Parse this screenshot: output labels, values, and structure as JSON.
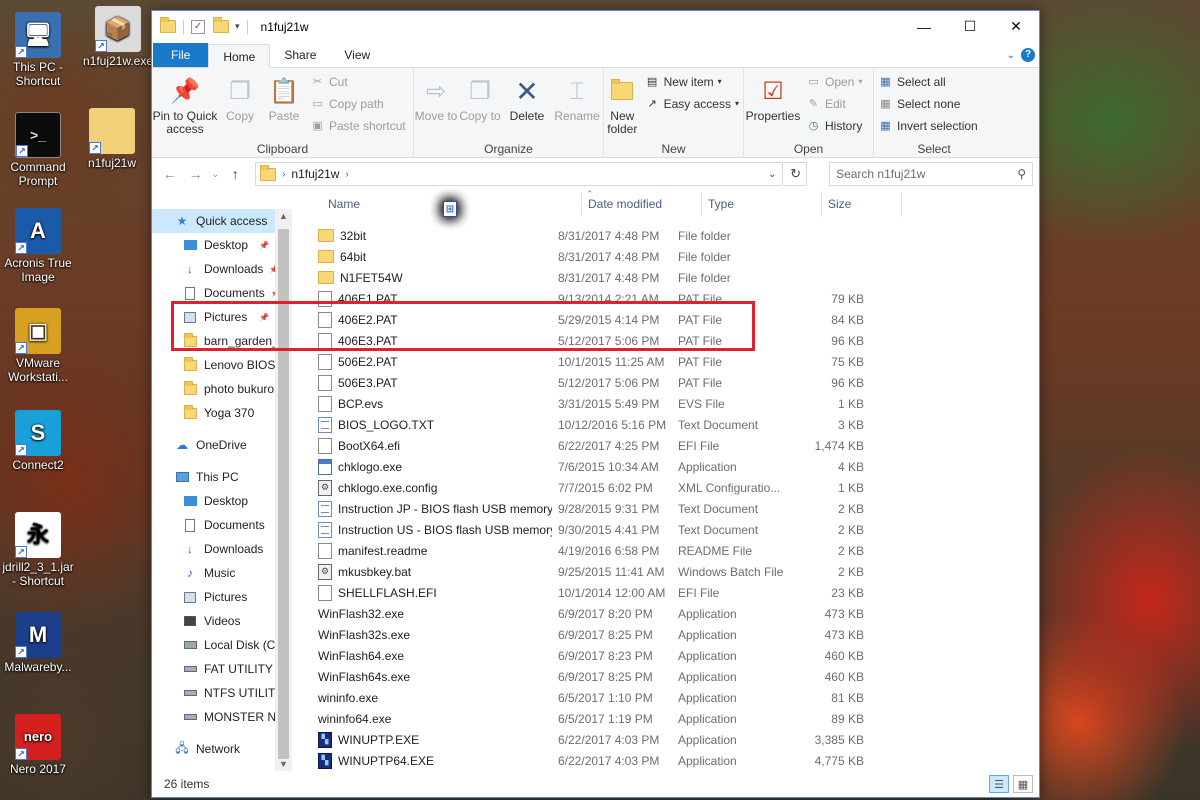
{
  "desktop": {
    "icons": [
      {
        "label": "This PC - Shortcut",
        "glyph": "🖥"
      },
      {
        "label": "n1fuj21w.exe",
        "glyph": "📦"
      },
      {
        "label": "Command Prompt",
        "glyph": ">_"
      },
      {
        "label": "n1fuj21w",
        "glyph": ""
      },
      {
        "label": "Acronis True Image",
        "glyph": "A"
      },
      {
        "label": "VMware Workstati...",
        "glyph": "▣"
      },
      {
        "label": "Connect2",
        "glyph": "S"
      },
      {
        "label": "jdrill2_3_1.jar - Shortcut",
        "glyph": "永"
      },
      {
        "label": "Malwareby...",
        "glyph": "M"
      },
      {
        "label": "Nero 2017",
        "glyph": "nero"
      }
    ]
  },
  "window": {
    "title": "n1fuj21w",
    "controls": {
      "minimize": "—",
      "maximize": "☐",
      "close": "✕"
    }
  },
  "tabs": {
    "file": "File",
    "home": "Home",
    "share": "Share",
    "view": "View"
  },
  "ribbon": {
    "clipboard": {
      "label": "Clipboard",
      "pin": "Pin to Quick access",
      "copy": "Copy",
      "paste": "Paste",
      "cut": "Cut",
      "copy_path": "Copy path",
      "paste_shortcut": "Paste shortcut"
    },
    "organize": {
      "label": "Organize",
      "move_to": "Move to",
      "copy_to": "Copy to",
      "delete": "Delete",
      "rename": "Rename"
    },
    "new": {
      "label": "New",
      "new_folder": "New folder",
      "new_item": "New item",
      "easy_access": "Easy access"
    },
    "open": {
      "label": "Open",
      "properties": "Properties",
      "open": "Open",
      "edit": "Edit",
      "history": "History"
    },
    "select": {
      "label": "Select",
      "select_all": "Select all",
      "select_none": "Select none",
      "invert": "Invert selection"
    }
  },
  "address": {
    "path": "n1fuj21w",
    "search_placeholder": "Search n1fuj21w"
  },
  "nav": {
    "quick_access": "Quick access",
    "quick_items": [
      {
        "label": "Desktop",
        "pinned": true
      },
      {
        "label": "Downloads",
        "pinned": true
      },
      {
        "label": "Documents",
        "pinned": true
      },
      {
        "label": "Pictures",
        "pinned": true
      },
      {
        "label": "barn_garden_wo",
        "pinned": false
      },
      {
        "label": "Lenovo BIOS Fla",
        "pinned": false
      },
      {
        "label": "photo bukuro",
        "pinned": false
      },
      {
        "label": "Yoga 370",
        "pinned": false
      }
    ],
    "onedrive": "OneDrive",
    "this_pc": "This PC",
    "pc_items": [
      {
        "label": "Desktop",
        "icon": "desktop-icon"
      },
      {
        "label": "Documents",
        "icon": "documents-icon"
      },
      {
        "label": "Downloads",
        "icon": "download-icon"
      },
      {
        "label": "Music",
        "icon": "music-icon"
      },
      {
        "label": "Pictures",
        "icon": "pictures-icon"
      },
      {
        "label": "Videos",
        "icon": "videos-icon"
      },
      {
        "label": "Local Disk (C:)",
        "icon": "local-disk-icon"
      },
      {
        "label": "FAT UTILITY (D:)",
        "icon": "drive-icon"
      },
      {
        "label": "NTFS UTILITY (E:",
        "icon": "drive-icon"
      },
      {
        "label": "MONSTER NTFS",
        "icon": "drive-icon"
      }
    ],
    "network": "Network"
  },
  "columns": {
    "name": "Name",
    "date": "Date modified",
    "type": "Type",
    "size": "Size"
  },
  "files": [
    {
      "name": "32bit",
      "date": "8/31/2017 4:48 PM",
      "type": "File folder",
      "size": "",
      "icon": "folder"
    },
    {
      "name": "64bit",
      "date": "8/31/2017 4:48 PM",
      "type": "File folder",
      "size": "",
      "icon": "folder"
    },
    {
      "name": "N1FET54W",
      "date": "8/31/2017 4:48 PM",
      "type": "File folder",
      "size": "",
      "icon": "folder"
    },
    {
      "name": "406E1.PAT",
      "date": "9/13/2014 2:21 AM",
      "type": "PAT File",
      "size": "79 KB",
      "icon": "doc"
    },
    {
      "name": "406E2.PAT",
      "date": "5/29/2015 4:14 PM",
      "type": "PAT File",
      "size": "84 KB",
      "icon": "doc"
    },
    {
      "name": "406E3.PAT",
      "date": "5/12/2017 5:06 PM",
      "type": "PAT File",
      "size": "96 KB",
      "icon": "doc"
    },
    {
      "name": "506E2.PAT",
      "date": "10/1/2015 11:25 AM",
      "type": "PAT File",
      "size": "75 KB",
      "icon": "doc"
    },
    {
      "name": "506E3.PAT",
      "date": "5/12/2017 5:06 PM",
      "type": "PAT File",
      "size": "96 KB",
      "icon": "doc"
    },
    {
      "name": "BCP.evs",
      "date": "3/31/2015 5:49 PM",
      "type": "EVS File",
      "size": "1 KB",
      "icon": "doc"
    },
    {
      "name": "BIOS_LOGO.TXT",
      "date": "10/12/2016 5:16 PM",
      "type": "Text Document",
      "size": "3 KB",
      "icon": "txt"
    },
    {
      "name": "BootX64.efi",
      "date": "6/22/2017 4:25 PM",
      "type": "EFI File",
      "size": "1,474 KB",
      "icon": "doc"
    },
    {
      "name": "chklogo.exe",
      "date": "7/6/2015 10:34 AM",
      "type": "Application",
      "size": "4 KB",
      "icon": "app"
    },
    {
      "name": "chklogo.exe.config",
      "date": "7/7/2015 6:02 PM",
      "type": "XML Configuratio...",
      "size": "1 KB",
      "icon": "gear"
    },
    {
      "name": "Instruction JP - BIOS flash USB memory k...",
      "date": "9/28/2015 9:31 PM",
      "type": "Text Document",
      "size": "2 KB",
      "icon": "txt"
    },
    {
      "name": "Instruction US - BIOS flash USB memory ...",
      "date": "9/30/2015 4:41 PM",
      "type": "Text Document",
      "size": "2 KB",
      "icon": "txt"
    },
    {
      "name": "manifest.readme",
      "date": "4/19/2016 6:58 PM",
      "type": "README File",
      "size": "2 KB",
      "icon": "doc"
    },
    {
      "name": "mkusbkey.bat",
      "date": "9/25/2015 11:41 AM",
      "type": "Windows Batch File",
      "size": "2 KB",
      "icon": "gear"
    },
    {
      "name": "SHELLFLASH.EFI",
      "date": "10/1/2014 12:00 AM",
      "type": "EFI File",
      "size": "23 KB",
      "icon": "doc"
    },
    {
      "name": "WinFlash32.exe",
      "date": "6/9/2017 8:20 PM",
      "type": "Application",
      "size": "473 KB",
      "icon": "win"
    },
    {
      "name": "WinFlash32s.exe",
      "date": "6/9/2017 8:25 PM",
      "type": "Application",
      "size": "473 KB",
      "icon": "win"
    },
    {
      "name": "WinFlash64.exe",
      "date": "6/9/2017 8:23 PM",
      "type": "Application",
      "size": "460 KB",
      "icon": "win"
    },
    {
      "name": "WinFlash64s.exe",
      "date": "6/9/2017 8:25 PM",
      "type": "Application",
      "size": "460 KB",
      "icon": "win"
    },
    {
      "name": "wininfo.exe",
      "date": "6/5/2017 1:10 PM",
      "type": "Application",
      "size": "81 KB",
      "icon": "win"
    },
    {
      "name": "wininfo64.exe",
      "date": "6/5/2017 1:19 PM",
      "type": "Application",
      "size": "89 KB",
      "icon": "win"
    },
    {
      "name": "WINUPTP.EXE",
      "date": "6/22/2017 4:03 PM",
      "type": "Application",
      "size": "3,385 KB",
      "icon": "blk"
    },
    {
      "name": "WINUPTP64.EXE",
      "date": "6/22/2017 4:03 PM",
      "type": "Application",
      "size": "4,775 KB",
      "icon": "blk"
    }
  ],
  "status": {
    "count": "26 items"
  },
  "colors": {
    "accent": "#1979ca",
    "highlight_box": "#e0202a",
    "selected_nav": "#cce8ff"
  }
}
